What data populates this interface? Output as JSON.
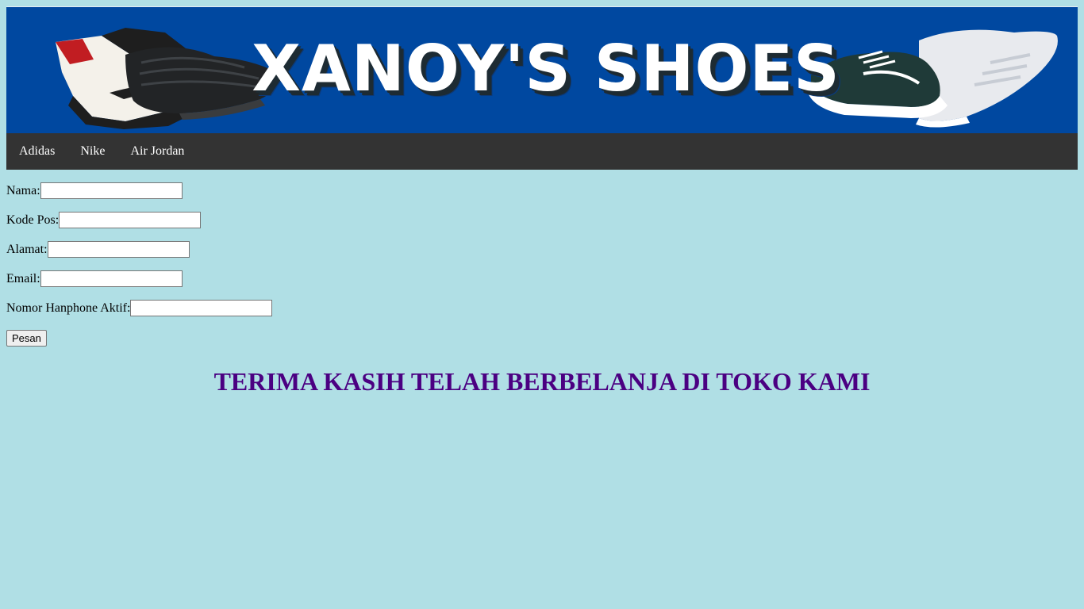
{
  "banner": {
    "title": "XANOY'S SHOES",
    "background_color": "#0048a0",
    "images": [
      "air-jordan-high-sneaker",
      "yeezy-knit-sneaker",
      "vans-old-skool-sneaker",
      "adidas-nmd-white-sneaker"
    ]
  },
  "nav": {
    "background_color": "#333333",
    "items": [
      {
        "label": "Adidas"
      },
      {
        "label": "Nike"
      },
      {
        "label": "Air Jordan"
      }
    ]
  },
  "form": {
    "fields": [
      {
        "label": "Nama:",
        "value": ""
      },
      {
        "label": "Kode Pos:",
        "value": ""
      },
      {
        "label": "Alamat:",
        "value": ""
      },
      {
        "label": "Email:",
        "value": ""
      },
      {
        "label": "Nomor Hanphone Aktif:",
        "value": ""
      }
    ],
    "submit_label": "Pesan"
  },
  "thanks_message": "TERIMA KASIH TELAH BERBELANJA DI TOKO KAMI",
  "colors": {
    "page_background": "#b0dfe5",
    "thanks_text": "#4b0082"
  }
}
